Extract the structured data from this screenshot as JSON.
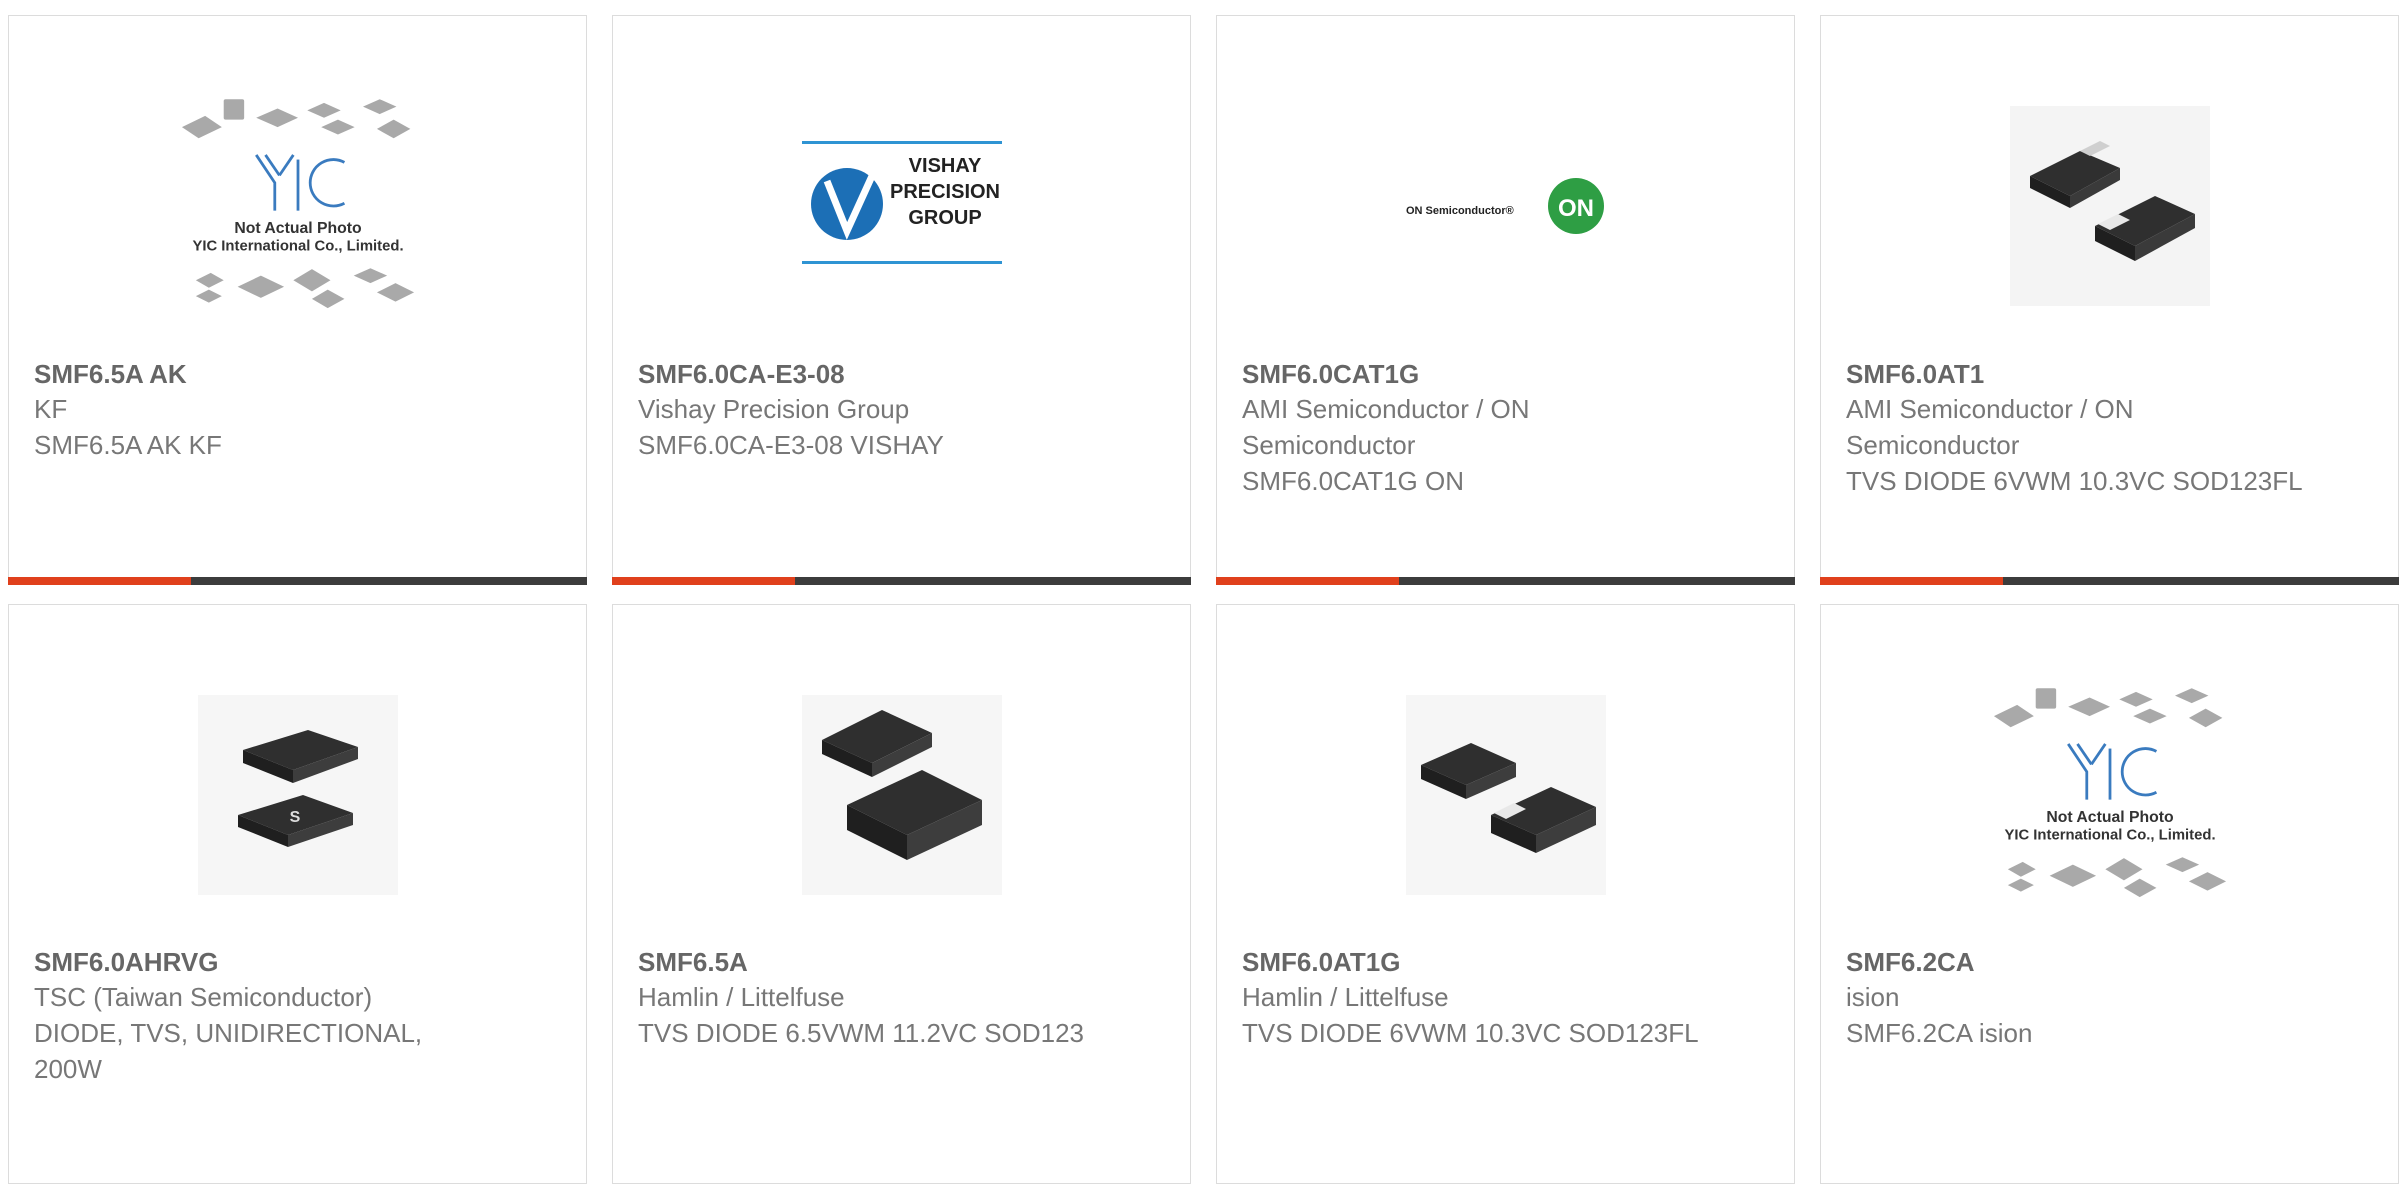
{
  "products": [
    {
      "part": "SMF6.5A AK",
      "maker": "KF",
      "desc": [
        "SMF6.5A AK KF"
      ],
      "image": "placeholder",
      "caption1": "Not Actual Photo",
      "caption2": "YIC International Co., Limited.",
      "logo": "YIC"
    },
    {
      "part": "SMF6.0CA-E3-08",
      "maker": "Vishay Precision Group",
      "desc": [
        "SMF6.0CA-E3-08 VISHAY"
      ],
      "image": "vishay-logo",
      "logo_lines": [
        "VISHAY",
        "PRECISION",
        "GROUP"
      ]
    },
    {
      "part": "SMF6.0CAT1G",
      "maker": "AMI Semiconductor / ON Semiconductor",
      "desc": [
        "SMF6.0CAT1G ON"
      ],
      "image": "on-logo",
      "logo_text": "ON Semiconductor®",
      "logo_badge": "ON"
    },
    {
      "part": "SMF6.0AT1",
      "maker": "AMI Semiconductor / ON Semiconductor",
      "desc": [
        "TVS DIODE 6VWM 10.3VC SOD123FL"
      ],
      "image": "component-photo"
    },
    {
      "part": "SMF6.0AHRVG",
      "maker": "TSC (Taiwan Semiconductor)",
      "desc": [
        "DIODE, TVS, UNIDIRECTIONAL, 200W"
      ],
      "image": "component-photo"
    },
    {
      "part": "SMF6.5A",
      "maker": "Hamlin / Littelfuse",
      "desc": [
        "TVS DIODE 6.5VWM 11.2VC SOD123"
      ],
      "image": "component-photo"
    },
    {
      "part": "SMF6.0AT1G",
      "maker": "Hamlin / Littelfuse",
      "desc": [
        "TVS DIODE 6VWM 10.3VC SOD123FL"
      ],
      "image": "component-photo"
    },
    {
      "part": "SMF6.2CA",
      "maker": "ision",
      "desc": [
        "SMF6.2CA ision"
      ],
      "image": "placeholder",
      "caption1": "Not Actual Photo",
      "caption2": "YIC International Co., Limited.",
      "logo": "YIC"
    }
  ],
  "colors": {
    "accent": "#e0401c",
    "bar": "#3c3c3c",
    "text": "#666666"
  }
}
